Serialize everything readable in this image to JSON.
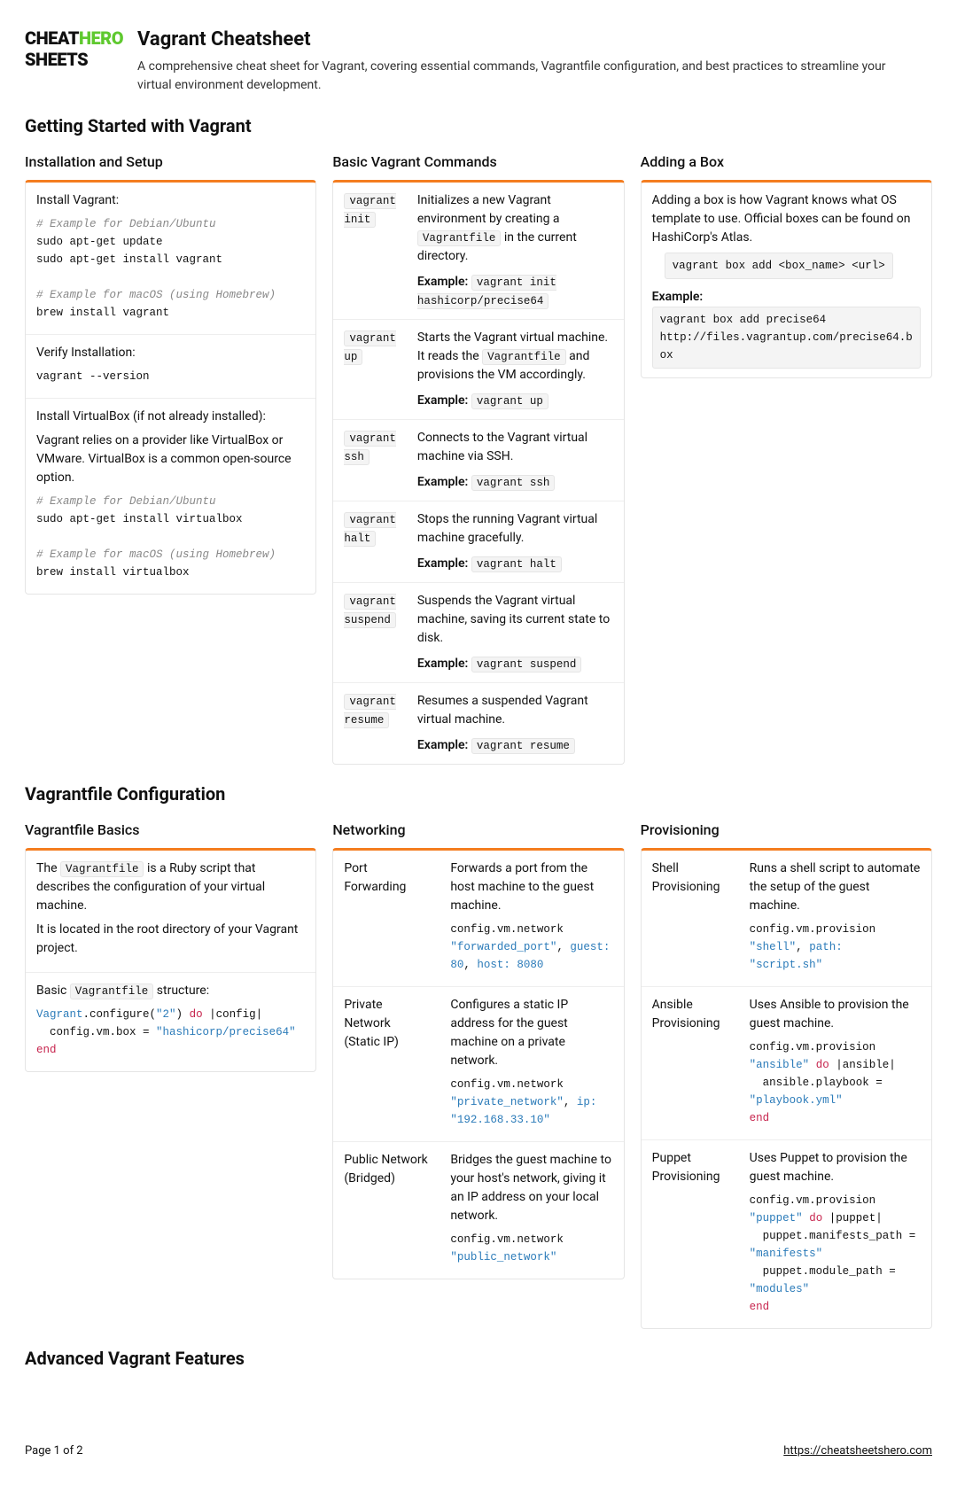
{
  "logo": {
    "line1a": "CHEAT",
    "line1b": "HERO",
    "line2": "SHEETS"
  },
  "header": {
    "title": "Vagrant Cheatsheet",
    "subtitle": "A comprehensive cheat sheet for Vagrant, covering essential commands, Vagrantfile configuration, and best practices to streamline your virtual environment development."
  },
  "s1": {
    "title": "Getting Started with Vagrant",
    "colA": {
      "title": "Installation and Setup",
      "p1": "Install Vagrant:",
      "c1a": "# Example for Debian/Ubuntu",
      "c1b": "sudo apt-get update",
      "c1c": "sudo apt-get install vagrant",
      "c1d": "# Example for macOS (using Homebrew)",
      "c1e": "brew install vagrant",
      "p2": "Verify Installation:",
      "c2": "vagrant --version",
      "p3": "Install VirtualBox (if not already installed):",
      "p3b": "Vagrant relies on a provider like VirtualBox or VMware. VirtualBox is a common open-source option.",
      "c3a": "# Example for Debian/Ubuntu",
      "c3b": "sudo apt-get install virtualbox",
      "c3c": "# Example for macOS (using Homebrew)",
      "c3d": "brew install virtualbox"
    },
    "colB": {
      "title": "Basic Vagrant Commands",
      "rows": [
        {
          "cmd": "vagrant init",
          "desc": "Initializes a new Vagrant environment by creating a ",
          "inlineCode": "Vagrantfile",
          "descAfter": " in the current directory.",
          "example": "vagrant init hashicorp/precise64"
        },
        {
          "cmd": "vagrant up",
          "desc": "Starts the Vagrant virtual machine. It reads the ",
          "inlineCode": "Vagrantfile",
          "descAfter": " and provisions the VM accordingly.",
          "example": "vagrant up"
        },
        {
          "cmd": "vagrant ssh",
          "desc": "Connects to the Vagrant virtual machine via SSH.",
          "example": "vagrant ssh"
        },
        {
          "cmd": "vagrant halt",
          "desc": "Stops the running Vagrant virtual machine gracefully.",
          "example": "vagrant halt"
        },
        {
          "cmd": "vagrant suspend",
          "desc": "Suspends the Vagrant virtual machine, saving its current state to disk.",
          "example": "vagrant suspend"
        },
        {
          "cmd": "vagrant resume",
          "desc": "Resumes a suspended Vagrant virtual machine.",
          "example": "vagrant resume"
        }
      ],
      "exampleLabel": "Example:"
    },
    "colC": {
      "title": "Adding a Box",
      "p1": "Adding a box is how Vagrant knows what OS template to use. Official boxes can be found on HashiCorp's Atlas.",
      "c1": "vagrant box add <box_name> <url>",
      "exLabel": "Example:",
      "c2": "vagrant box add precise64 http://files.vagrantup.com/precise64.box"
    }
  },
  "s2": {
    "title": "Vagrantfile Configuration",
    "colA": {
      "title": "Vagrantfile Basics",
      "p1a": "The ",
      "p1code": "Vagrantfile",
      "p1b": " is a Ruby script that describes the configuration of your virtual machine.",
      "p2": "It is located in the root directory of your Vagrant project.",
      "p3a": "Basic ",
      "p3code": "Vagrantfile",
      "p3b": " structure:"
    },
    "colB": {
      "title": "Networking",
      "rows": [
        {
          "name": "Port Forwarding",
          "desc": "Forwards a port from the host machine to the guest machine."
        },
        {
          "name": "Private Network (Static IP)",
          "desc": "Configures a static IP address for the guest machine on a private network."
        },
        {
          "name": "Public Network (Bridged)",
          "desc": "Bridges the guest machine to your host's network, giving it an IP address on your local network."
        }
      ]
    },
    "colC": {
      "title": "Provisioning",
      "rows": [
        {
          "name": "Shell Provisioning",
          "desc": "Runs a shell script to automate the setup of the guest machine."
        },
        {
          "name": "Ansible Provisioning",
          "desc": "Uses Ansible to provision the guest machine."
        },
        {
          "name": "Puppet Provisioning",
          "desc": "Uses Puppet to provision the guest machine."
        }
      ]
    }
  },
  "s3": {
    "title": "Advanced Vagrant Features"
  },
  "footer": {
    "page": "Page 1 of 2",
    "url": "https://cheatsheetshero.com"
  }
}
